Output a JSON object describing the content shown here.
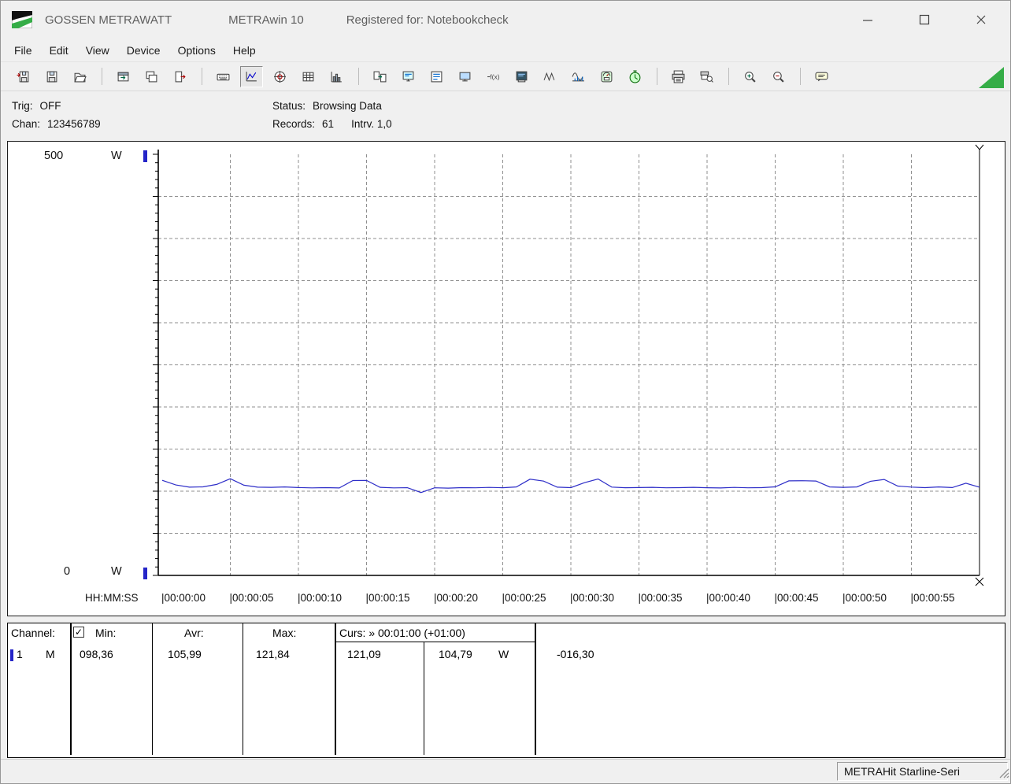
{
  "window_title": {
    "brand": "GOSSEN METRAWATT",
    "app": "METRAwin 10",
    "registered": "Registered for: Notebookcheck"
  },
  "menu": {
    "items": [
      "File",
      "Edit",
      "View",
      "Device",
      "Options",
      "Help"
    ]
  },
  "toolbar": {
    "groups": [
      [
        {
          "name": "export-file-icon"
        },
        {
          "name": "save-icon"
        },
        {
          "name": "open-file-icon"
        }
      ],
      [
        {
          "name": "import-window-icon"
        },
        {
          "name": "copy-window-icon"
        },
        {
          "name": "exit-icon"
        }
      ],
      [
        {
          "name": "keyboard-icon"
        },
        {
          "name": "line-chart-icon",
          "selected": true
        },
        {
          "name": "scope-view-icon"
        },
        {
          "name": "table-view-icon"
        },
        {
          "name": "histogram-view-icon"
        }
      ],
      [
        {
          "name": "transfer-icon"
        },
        {
          "name": "device-config-icon"
        },
        {
          "name": "device-list-icon"
        },
        {
          "name": "monitor-icon"
        },
        {
          "name": "function-icon"
        },
        {
          "name": "display-icon"
        },
        {
          "name": "waveform-icon"
        },
        {
          "name": "harmonics-icon"
        },
        {
          "name": "meter-icon"
        },
        {
          "name": "timer-icon"
        }
      ],
      [
        {
          "name": "print-icon"
        },
        {
          "name": "print-preview-icon"
        }
      ],
      [
        {
          "name": "zoom-in-icon"
        },
        {
          "name": "zoom-out-icon"
        }
      ],
      [
        {
          "name": "annotation-icon"
        }
      ]
    ]
  },
  "infobar": {
    "trig_label": "Trig:",
    "trig_value": "OFF",
    "chan_label": "Chan:",
    "chan_value": "123456789",
    "status_label": "Status:",
    "status_value": "Browsing Data",
    "records_label": "Records:",
    "records_value": "61",
    "interval_value": "Intrv. 1,0"
  },
  "chart_data": {
    "type": "line",
    "title": "",
    "ylabel": "W",
    "y_axis": {
      "min": 0,
      "max": 500,
      "top_label": "500",
      "bottom_label": "0",
      "unit_label": "W",
      "grid_step": 50,
      "tick_step": 10
    },
    "x_axis": {
      "caption": "HH:MM:SS",
      "min_s": 0,
      "max_s": 60,
      "tick_step_s": 5,
      "tick_labels": [
        "00:00:00",
        "00:00:05",
        "00:00:10",
        "00:00:15",
        "00:00:20",
        "00:00:25",
        "00:00:30",
        "00:00:35",
        "00:00:40",
        "00:00:45",
        "00:00:50",
        "00:00:55"
      ]
    },
    "cursor": {
      "position_s": 60,
      "time_label": "00:01:00"
    },
    "grid": true,
    "series": [
      {
        "name": "channel-1-power-W",
        "color": "#2e2ec8",
        "x_start_s": 0,
        "interval_s": 1,
        "values": [
          112.9,
          107.4,
          104.8,
          105.1,
          108.0,
          114.8,
          107.1,
          104.8,
          104.6,
          105.0,
          104.3,
          103.9,
          104.2,
          103.8,
          112.6,
          112.8,
          104.6,
          103.9,
          104.1,
          98.4,
          104.0,
          103.6,
          104.2,
          104.0,
          104.5,
          104.1,
          105.0,
          114.2,
          112.0,
          104.8,
          104.2,
          110.1,
          114.5,
          104.9,
          104.1,
          104.3,
          104.6,
          104.0,
          104.2,
          104.6,
          104.1,
          103.8,
          104.5,
          104.0,
          104.2,
          105.1,
          112.2,
          112.4,
          112.1,
          105.0,
          104.6,
          105.0,
          111.8,
          113.9,
          106.1,
          104.9,
          104.2,
          105.0,
          104.3,
          109.4,
          104.8
        ]
      }
    ]
  },
  "values_panel": {
    "header": {
      "channel": "Channel:",
      "checked": true,
      "min": "Min:",
      "avr": "Avr:",
      "max": "Max:",
      "curs": "Curs: » 00:01:00 (+01:00)"
    },
    "row": {
      "channel": "1",
      "mode": "M",
      "min": "098,36",
      "avr": "105,99",
      "max": "121,84",
      "curs1": "121,09",
      "curs2": "104,79",
      "unit": "W",
      "delta": "-016,30"
    }
  },
  "statusbar": {
    "device": "METRAHit Starline-Seri"
  }
}
